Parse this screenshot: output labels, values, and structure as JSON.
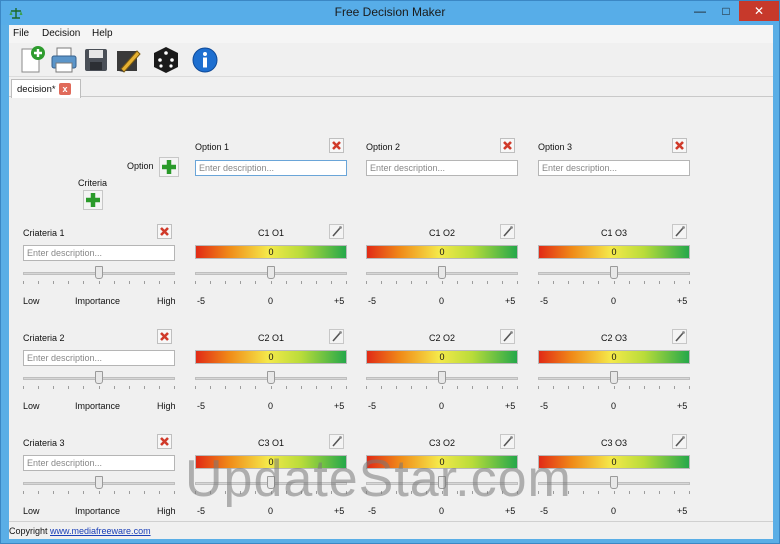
{
  "window": {
    "title": "Free Decision Maker"
  },
  "menu": [
    "File",
    "Decision",
    "Help"
  ],
  "toolbar": {
    "icons": [
      "new-icon",
      "print-icon",
      "save-icon",
      "edit-icon",
      "dice-icon",
      "info-icon"
    ]
  },
  "tab": {
    "label": "decision*"
  },
  "criteria_header": {
    "option_label": "Option",
    "criteria_label": "Criteria"
  },
  "options": [
    {
      "label": "Option 1",
      "placeholder": "Enter description..."
    },
    {
      "label": "Option 2",
      "placeholder": "Enter description..."
    },
    {
      "label": "Option 3",
      "placeholder": "Enter description..."
    }
  ],
  "criteria": [
    {
      "label": "Criateria 1",
      "placeholder": "Enter description...",
      "low": "Low",
      "importance": "Importance",
      "high": "High",
      "cells": [
        {
          "label": "C1 O1",
          "value": "0"
        },
        {
          "label": "C1 O2",
          "value": "0"
        },
        {
          "label": "C1 O3",
          "value": "0"
        }
      ]
    },
    {
      "label": "Criateria 2",
      "placeholder": "Enter description...",
      "low": "Low",
      "importance": "Importance",
      "high": "High",
      "cells": [
        {
          "label": "C2 O1",
          "value": "0"
        },
        {
          "label": "C2 O2",
          "value": "0"
        },
        {
          "label": "C2 O3",
          "value": "0"
        }
      ]
    },
    {
      "label": "Criateria 3",
      "placeholder": "Enter description...",
      "low": "Low",
      "importance": "Importance",
      "high": "High",
      "cells": [
        {
          "label": "C3 O1",
          "value": "0"
        },
        {
          "label": "C3 O2",
          "value": "0"
        },
        {
          "label": "C3 O3",
          "value": "0"
        }
      ]
    }
  ],
  "scale": {
    "min": "-5",
    "mid": "0",
    "max": "+5"
  },
  "status": {
    "prefix": "Copyright ",
    "link": "www.mediafreeware.com"
  },
  "watermark": "UpdateStar.com"
}
